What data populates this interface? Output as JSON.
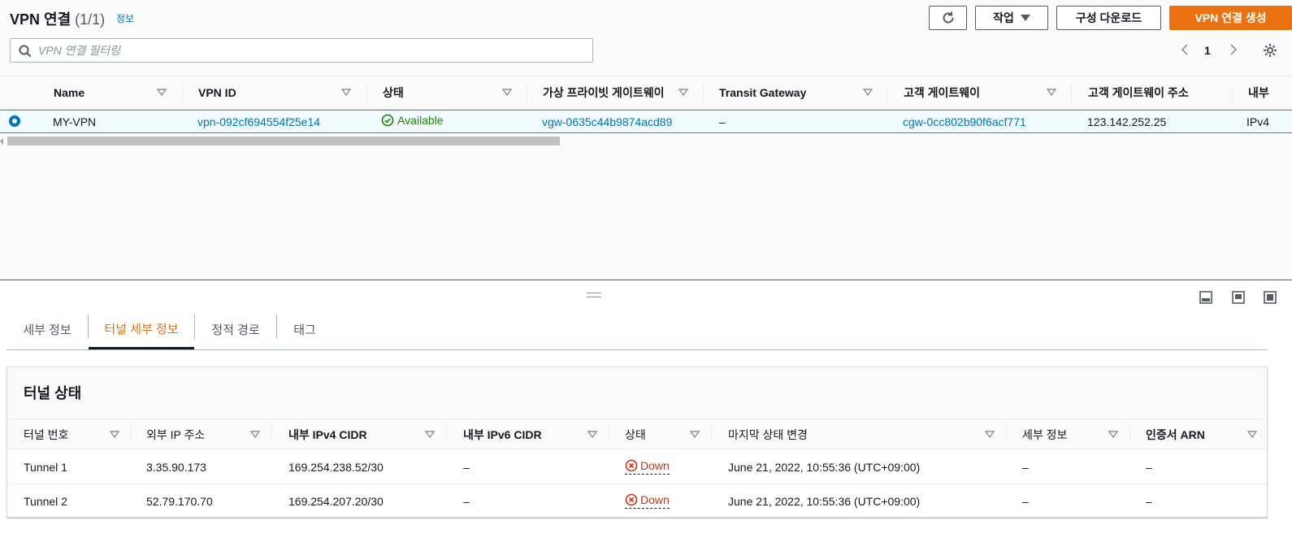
{
  "header": {
    "title": "VPN 연결",
    "count": "(1/1)",
    "info_link": "정보",
    "refresh_icon": "refresh-icon",
    "actions_label": "작업",
    "download_label": "구성 다운로드",
    "create_label": "VPN 연결 생성"
  },
  "filter": {
    "placeholder": "VPN 연결 필터링"
  },
  "pagination": {
    "current_page": "1"
  },
  "table": {
    "columns": [
      "Name",
      "VPN ID",
      "상태",
      "가상 프라이빗 게이트웨이",
      "Transit Gateway",
      "고객 게이트웨이",
      "고객 게이트웨이 주소",
      "내부"
    ],
    "rows": [
      {
        "name": "MY-VPN",
        "vpn_id": "vpn-092cf694554f25e14",
        "status": "Available",
        "vgw": "vgw-0635c44b9874acd89",
        "transit_gateway": "–",
        "cgw": "cgw-0cc802b90f6acf771",
        "cgw_address": "123.142.252.25",
        "inner": "IPv4"
      }
    ]
  },
  "tabs": [
    "세부 정보",
    "터널 세부 정보",
    "정적 경로",
    "태그"
  ],
  "active_tab": "터널 세부 정보",
  "tunnel_card": {
    "title": "터널 상태",
    "columns": [
      "터널 번호",
      "외부 IP 주소",
      "내부 IPv4 CIDR",
      "내부 IPv6 CIDR",
      "상태",
      "마지막 상태 변경",
      "세부 정보",
      "인증서 ARN"
    ],
    "rows": [
      {
        "tunnel": "Tunnel 1",
        "outside_ip": "3.35.90.173",
        "ipv4_cidr": "169.254.238.52/30",
        "ipv6_cidr": "–",
        "status": "Down",
        "last_change": "June 21, 2022, 10:55:36 (UTC+09:00)",
        "details": "–",
        "cert_arn": "–"
      },
      {
        "tunnel": "Tunnel 2",
        "outside_ip": "52.79.170.70",
        "ipv4_cidr": "169.254.207.20/30",
        "ipv6_cidr": "–",
        "status": "Down",
        "last_change": "June 21, 2022, 10:55:36 (UTC+09:00)",
        "details": "–",
        "cert_arn": "–"
      }
    ]
  },
  "colors": {
    "accent": "#ec7211",
    "link": "#0073bb",
    "success": "#1d8102",
    "error": "#d13212"
  }
}
